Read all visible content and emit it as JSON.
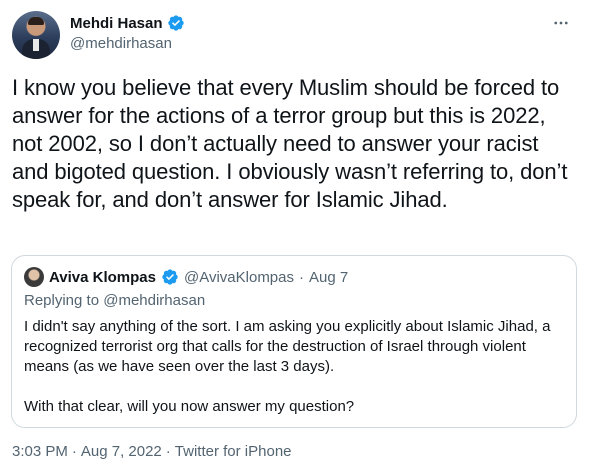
{
  "author": {
    "display_name": "Mehdi Hasan",
    "handle": "@mehdirhasan",
    "verified": true
  },
  "tweet": {
    "text": "I know you believe that every Muslim should be forced to answer for the actions of a terror group but this is 2022, not 2002, so I don’t actually need to answer your racist and bigoted question. I obviously wasn’t referring to, don’t speak for, and don’t answer for Islamic Jihad."
  },
  "quoted_tweet": {
    "display_name": "Aviva Klompas",
    "handle": "@AvivaKlompas",
    "separator": "·",
    "date": "Aug 7",
    "replying_prefix": "Replying to ",
    "replying_to": "@mehdirhasan",
    "paragraphs": [
      "I didn't say anything of the sort. I am asking you explicitly about Islamic Jihad, a recognized terrorist org that calls for the destruction of Israel through violent means (as we have seen over the last 3 days).",
      "With that clear, will you now answer my question?"
    ]
  },
  "meta": {
    "time": "3:03 PM",
    "separator1": "·",
    "date": "Aug 7, 2022",
    "separator2": "·",
    "source": "Twitter for iPhone"
  },
  "colors": {
    "verified": "#1d9bf0",
    "secondary_text": "#536471",
    "border": "#cfd9de"
  },
  "icons": {
    "more": "more-horizontal-icon",
    "verified": "verified-badge-icon"
  }
}
